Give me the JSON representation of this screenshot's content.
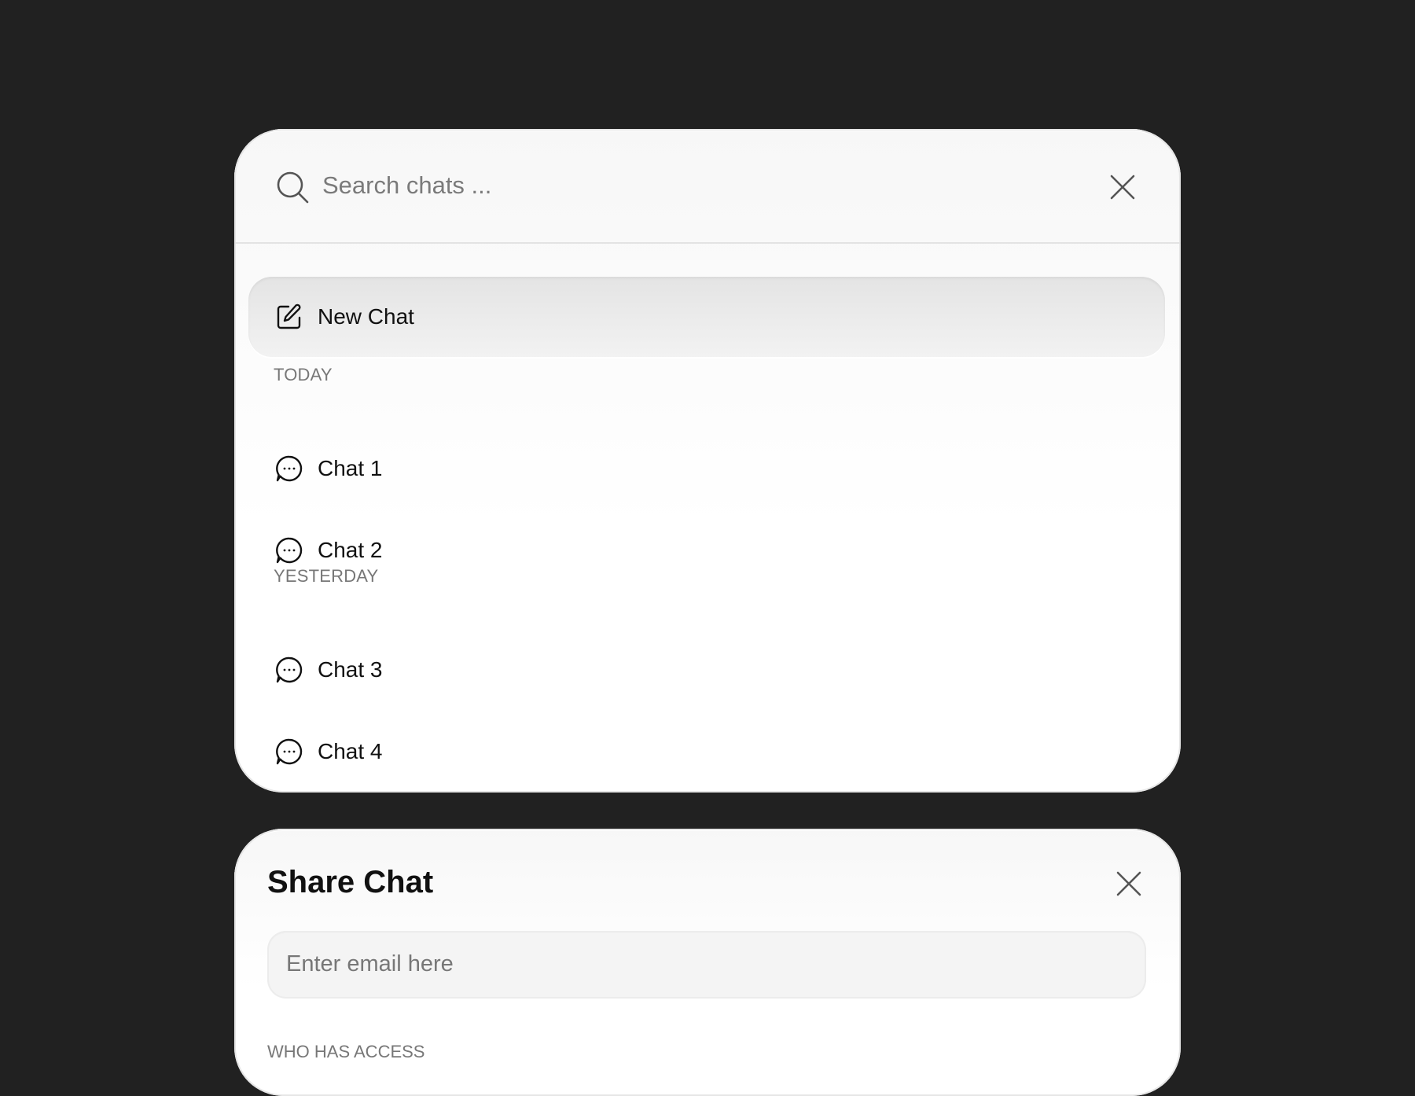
{
  "search_panel": {
    "search": {
      "placeholder": "Search chats ..."
    },
    "new_chat": {
      "label": "New Chat"
    },
    "sections": [
      {
        "heading": "TODAY",
        "chats": [
          {
            "label": "Chat 1"
          },
          {
            "label": "Chat 2"
          }
        ]
      },
      {
        "heading": "YESTERDAY",
        "chats": [
          {
            "label": "Chat 3"
          },
          {
            "label": "Chat 4"
          }
        ]
      }
    ]
  },
  "share_panel": {
    "title": "Share Chat",
    "email": {
      "placeholder": "Enter email here"
    },
    "access_heading": "WHO HAS ACCESS"
  },
  "colors": {
    "background": "#212121",
    "panel": "#ffffff",
    "muted_text": "#777777",
    "primary_text": "#111111"
  }
}
